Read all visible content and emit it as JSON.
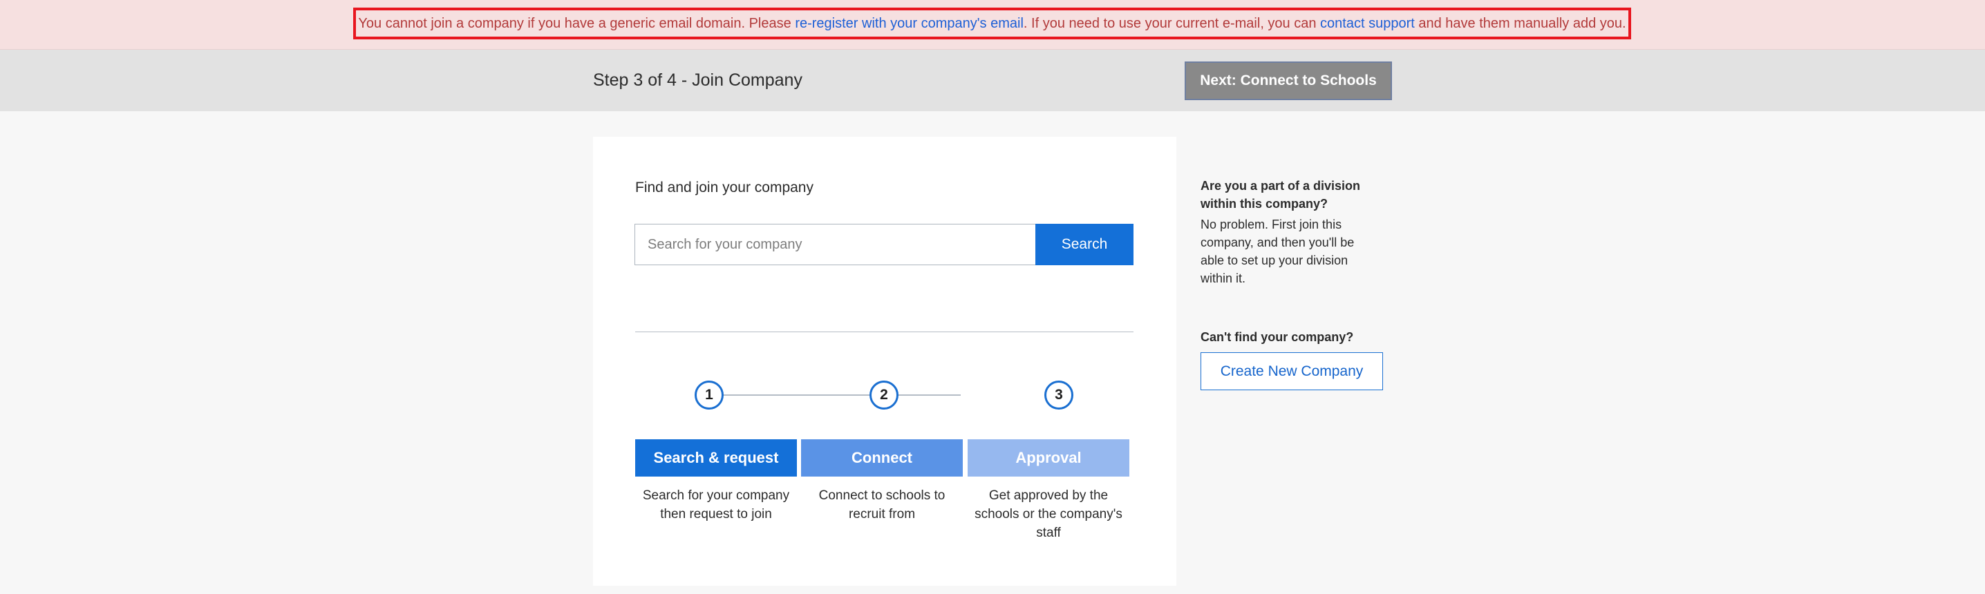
{
  "alert": {
    "text_before": "You cannot join a company if you have a generic email domain. Please ",
    "link_reregister": "re-register with your company's email",
    "text_middle": ". If you need to use your current e-mail, you can ",
    "link_support": "contact support",
    "text_after": " and have them manually add you."
  },
  "header": {
    "step_title": "Step 3 of 4 - Join Company",
    "next_label": "Next: Connect to Schools"
  },
  "main": {
    "find_title": "Find and join your company",
    "search_placeholder": "Search for your company",
    "search_value": "",
    "search_label": "Search",
    "steps": [
      {
        "number": "1",
        "label": "Search & request",
        "color": "#1470d8",
        "desc_line1": "Search for your company",
        "desc_line2": "then request to join",
        "desc_line3": ""
      },
      {
        "number": "2",
        "label": "Connect",
        "color": "#5a93e6",
        "desc_line1": "Connect to schools to",
        "desc_line2": "recruit from",
        "desc_line3": ""
      },
      {
        "number": "3",
        "label": "Approval",
        "color": "#96b8ef",
        "desc_line1": "Get approved by the",
        "desc_line2": "schools or the company's",
        "desc_line3": "staff"
      }
    ]
  },
  "side": {
    "question_line1": "Are you a part of a division",
    "question_line2": "within this company?",
    "answer_line1": "No problem. First join this",
    "answer_line2": "company, and then you'll be",
    "answer_line3": "able to set up your division",
    "answer_line4": "within it.",
    "cant_find": "Can't find your company?",
    "create_label": "Create New Company"
  },
  "colors": {
    "primary": "#1470d8",
    "alert_border": "#e8161f",
    "alert_text": "#b23a3a"
  }
}
